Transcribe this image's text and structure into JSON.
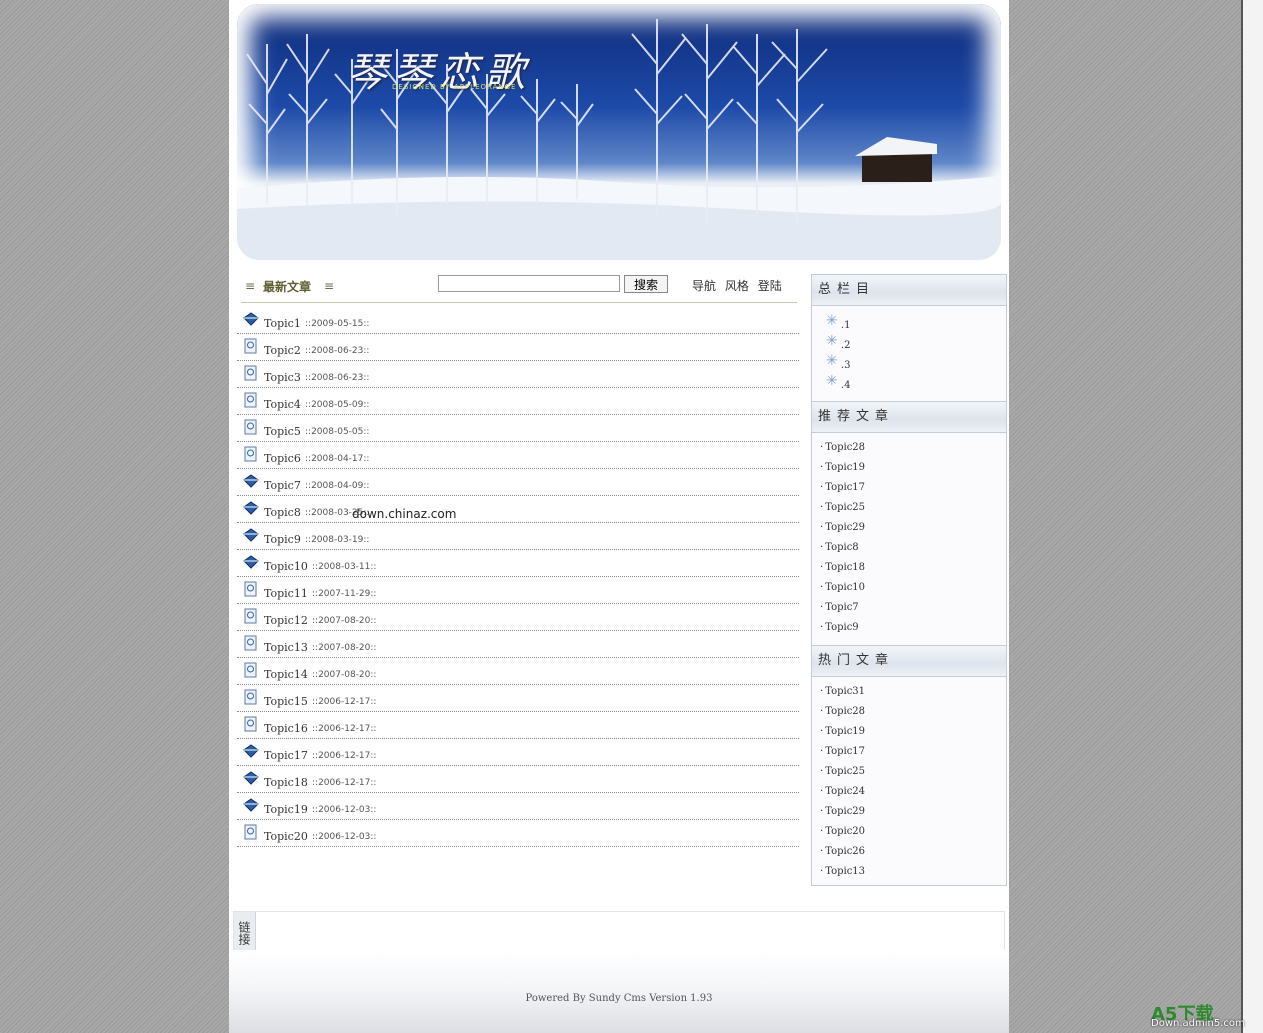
{
  "banner": {
    "title": "琴琴恋歌",
    "subtitle": "DESIGNED BY APPLEORANGE"
  },
  "main": {
    "title": "最新文章",
    "search_placeholder": "",
    "search_button": "搜索",
    "top_links": [
      "导航",
      "风格",
      "登陆"
    ],
    "articles": [
      {
        "title": "Topic1",
        "date": "::2009-05-15::",
        "icon": "diamond-icon"
      },
      {
        "title": "Topic2",
        "date": "::2008-06-23::",
        "icon": "page-icon"
      },
      {
        "title": "Topic3",
        "date": "::2008-06-23::",
        "icon": "page-icon"
      },
      {
        "title": "Topic4",
        "date": "::2008-05-09::",
        "icon": "page-icon"
      },
      {
        "title": "Topic5",
        "date": "::2008-05-05::",
        "icon": "page-icon"
      },
      {
        "title": "Topic6",
        "date": "::2008-04-17::",
        "icon": "page-icon"
      },
      {
        "title": "Topic7",
        "date": "::2008-04-09::",
        "icon": "diamond-icon"
      },
      {
        "title": "Topic8",
        "date": "::2008-03-25::",
        "icon": "diamond-icon"
      },
      {
        "title": "Topic9",
        "date": "::2008-03-19::",
        "icon": "diamond-icon"
      },
      {
        "title": "Topic10",
        "date": "::2008-03-11::",
        "icon": "diamond-icon"
      },
      {
        "title": "Topic11",
        "date": "::2007-11-29::",
        "icon": "page-icon"
      },
      {
        "title": "Topic12",
        "date": "::2007-08-20::",
        "icon": "page-icon"
      },
      {
        "title": "Topic13",
        "date": "::2007-08-20::",
        "icon": "page-icon"
      },
      {
        "title": "Topic14",
        "date": "::2007-08-20::",
        "icon": "page-icon"
      },
      {
        "title": "Topic15",
        "date": "::2006-12-17::",
        "icon": "page-icon"
      },
      {
        "title": "Topic16",
        "date": "::2006-12-17::",
        "icon": "page-icon"
      },
      {
        "title": "Topic17",
        "date": "::2006-12-17::",
        "icon": "diamond-icon"
      },
      {
        "title": "Topic18",
        "date": "::2006-12-17::",
        "icon": "diamond-icon"
      },
      {
        "title": "Topic19",
        "date": "::2006-12-03::",
        "icon": "diamond-icon"
      },
      {
        "title": "Topic20",
        "date": "::2006-12-03::",
        "icon": "page-icon"
      }
    ]
  },
  "watermark": "down.chinaz.com",
  "sidebar": {
    "categories_title": "总栏目",
    "categories": [
      ".1",
      ".2",
      ".3",
      ".4"
    ],
    "recommended_title": "推荐文章",
    "recommended": [
      "Topic28",
      "Topic19",
      "Topic17",
      "Topic25",
      "Topic29",
      "Topic8",
      "Topic18",
      "Topic10",
      "Topic7",
      "Topic9"
    ],
    "hot_title": "热门文章",
    "hot": [
      "Topic31",
      "Topic28",
      "Topic19",
      "Topic17",
      "Topic25",
      "Topic24",
      "Topic29",
      "Topic20",
      "Topic26",
      "Topic13"
    ]
  },
  "links_label": "链接",
  "footer": "Powered By Sundy Cms  Version 1.93",
  "corner_logo": "A5下载",
  "corner_url": "Down.admin5.com",
  "colors": {
    "accent": "#5e5e32",
    "banner_sky": "#1d4aa8",
    "sidebar_border": "#c4cbd6"
  }
}
